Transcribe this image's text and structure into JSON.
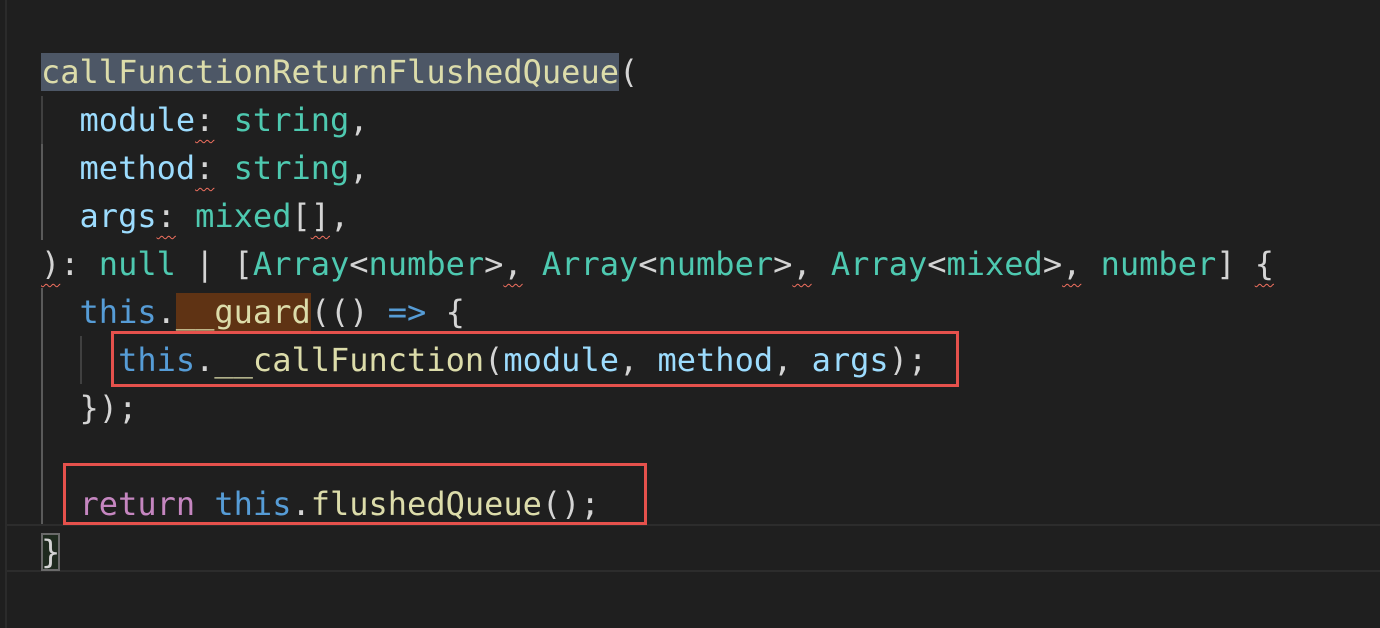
{
  "editor": {
    "lines": [
      [
        [
          "callFunctionReturnFlushedQueue",
          "fn sel"
        ],
        [
          "(",
          "punc"
        ]
      ],
      [
        [
          "  ",
          ""
        ],
        [
          "module",
          "param"
        ],
        [
          ":",
          "punc err"
        ],
        [
          " ",
          ""
        ],
        [
          "string",
          "type"
        ],
        [
          ",",
          "punc"
        ]
      ],
      [
        [
          "  ",
          ""
        ],
        [
          "method",
          "param"
        ],
        [
          ":",
          "punc err"
        ],
        [
          " ",
          ""
        ],
        [
          "string",
          "type"
        ],
        [
          ",",
          "punc"
        ]
      ],
      [
        [
          "  ",
          ""
        ],
        [
          "args",
          "param"
        ],
        [
          ":",
          "punc err"
        ],
        [
          " ",
          ""
        ],
        [
          "mixed",
          "type"
        ],
        [
          "[",
          "punc"
        ],
        [
          "]",
          "punc err"
        ],
        [
          ",",
          "punc"
        ]
      ],
      [
        [
          ")",
          "punc err"
        ],
        [
          ": ",
          "punc"
        ],
        [
          "null",
          "type"
        ],
        [
          " | [",
          "punc"
        ],
        [
          "Array",
          "type"
        ],
        [
          "<",
          "punc"
        ],
        [
          "number",
          "type"
        ],
        [
          ">",
          "punc"
        ],
        [
          ",",
          "punc err"
        ],
        [
          " ",
          ""
        ],
        [
          "Array",
          "type"
        ],
        [
          "<",
          "punc"
        ],
        [
          "number",
          "type"
        ],
        [
          ">",
          "punc"
        ],
        [
          ",",
          "punc err"
        ],
        [
          " ",
          ""
        ],
        [
          "Array",
          "type"
        ],
        [
          "<",
          "punc"
        ],
        [
          "mixed",
          "type"
        ],
        [
          ">",
          "punc"
        ],
        [
          ",",
          "punc err"
        ],
        [
          " ",
          ""
        ],
        [
          "number",
          "type"
        ],
        [
          "] ",
          "punc"
        ],
        [
          "{",
          "punc err"
        ]
      ],
      [
        [
          "  ",
          ""
        ],
        [
          "this",
          "this"
        ],
        [
          ".",
          "punc"
        ],
        [
          "__guard",
          "fn hl"
        ],
        [
          "(() ",
          "punc"
        ],
        [
          "=>",
          "op"
        ],
        [
          " {",
          "punc"
        ]
      ],
      [
        [
          "    ",
          ""
        ],
        [
          "this",
          "this"
        ],
        [
          ".",
          "punc"
        ],
        [
          "__callFunction",
          "fn"
        ],
        [
          "(",
          "punc"
        ],
        [
          "module",
          "param"
        ],
        [
          ", ",
          "punc"
        ],
        [
          "method",
          "param"
        ],
        [
          ", ",
          "punc"
        ],
        [
          "args",
          "param"
        ],
        [
          ");",
          "punc"
        ]
      ],
      [
        [
          "  ",
          ""
        ],
        [
          "});",
          "punc"
        ]
      ],
      [],
      [
        [
          "  ",
          ""
        ],
        [
          "return",
          "kw"
        ],
        [
          " ",
          ""
        ],
        [
          "this",
          "this"
        ],
        [
          ".",
          "punc"
        ],
        [
          "flushedQueue",
          "fn"
        ],
        [
          "();",
          "punc"
        ]
      ],
      [
        [
          "}",
          "punc bracket-match"
        ]
      ]
    ]
  }
}
